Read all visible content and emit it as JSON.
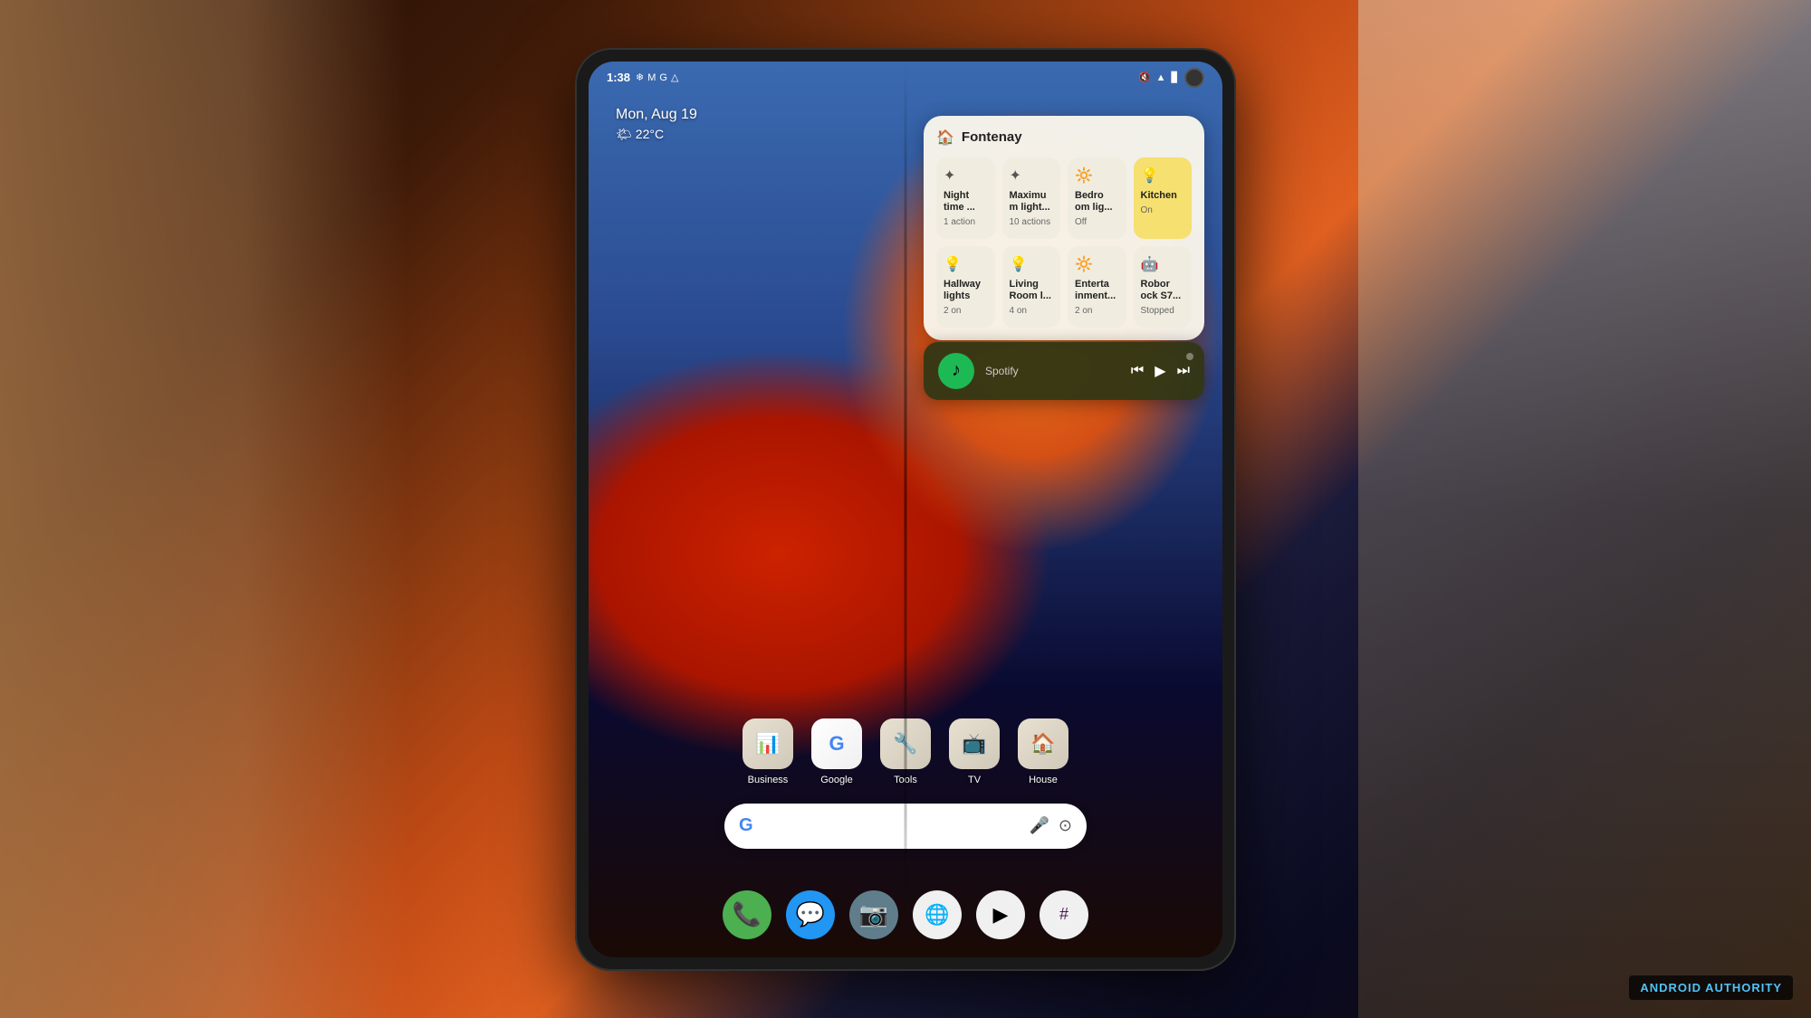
{
  "background": {
    "description": "Android phone held in hand, colorful geometric wallpaper"
  },
  "status_bar": {
    "time": "1:38",
    "icons": [
      "snowflake",
      "M",
      "G",
      "location"
    ],
    "right_icons": [
      "mute",
      "wifi",
      "battery"
    ]
  },
  "date_weather": {
    "date": "Mon, Aug 19",
    "weather_icon": "🌤",
    "temperature": "22°C"
  },
  "smart_home_widget": {
    "title": "Fontenay",
    "tiles": [
      {
        "icon": "✦",
        "name": "Night time ...",
        "status": "1 action",
        "active": false
      },
      {
        "icon": "✦",
        "name": "Maximu m light...",
        "status": "10 actions",
        "active": false
      },
      {
        "icon": "🔆",
        "name": "Bedro om lig...",
        "status": "Off",
        "active": false
      },
      {
        "icon": "💡",
        "name": "Kitchen",
        "status": "On",
        "active": true
      },
      {
        "icon": "💡",
        "name": "Hallway lights",
        "status": "2 on",
        "active": false
      },
      {
        "icon": "💡",
        "name": "Living Room l...",
        "status": "4 on",
        "active": false
      },
      {
        "icon": "🔆",
        "name": "Enterta inment...",
        "status": "2 on",
        "active": false
      },
      {
        "icon": "🤖",
        "name": "Robor ock S7...",
        "status": "Stopped",
        "active": false
      }
    ]
  },
  "spotify_widget": {
    "app_name": "Spotify",
    "controls": [
      "prev",
      "play",
      "next"
    ]
  },
  "app_icons": [
    {
      "name": "Business",
      "emoji": "📊",
      "color": "business"
    },
    {
      "name": "Google",
      "emoji": "G",
      "color": "google"
    },
    {
      "name": "Tools",
      "emoji": "🔧",
      "color": "tools"
    },
    {
      "name": "TV",
      "emoji": "📺",
      "color": "tv"
    },
    {
      "name": "House",
      "emoji": "🏠",
      "color": "house"
    }
  ],
  "search_bar": {
    "placeholder": "",
    "g_colors": [
      "blue",
      "red",
      "yellow",
      "blue",
      "green",
      "red"
    ]
  },
  "dock_apps": [
    {
      "name": "Phone",
      "emoji": "📞",
      "color": "dock-phone"
    },
    {
      "name": "Messages",
      "emoji": "💬",
      "color": "dock-msg"
    },
    {
      "name": "Camera",
      "emoji": "📷",
      "color": "dock-camera"
    },
    {
      "name": "Chrome",
      "emoji": "⚪",
      "color": "dock-chrome"
    },
    {
      "name": "Play Store",
      "emoji": "▶",
      "color": "dock-play"
    },
    {
      "name": "Slack",
      "emoji": "#",
      "color": "dock-slack"
    }
  ],
  "watermark": {
    "brand": "ANDROID",
    "suffix": "AUTHORITY"
  }
}
